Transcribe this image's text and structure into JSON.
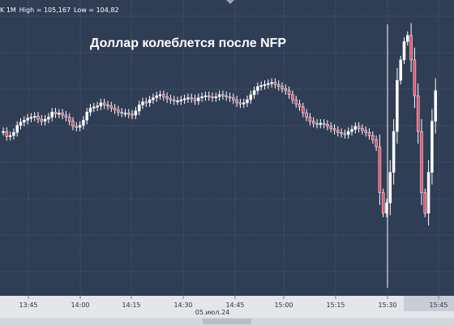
{
  "info": {
    "prefix": "K 1M",
    "high": "High = 105,167",
    "low": "Low = 104,82"
  },
  "headline": "Доллар колеблется после NFP",
  "colors": {
    "background": "#2f3d55",
    "axis_bar": "#e4e6ea",
    "grid": "#56627a",
    "up_candle": "#ffffff",
    "down_candle": "#e8506a",
    "news_line": "#ffffff"
  },
  "chart_data": {
    "type": "candlestick",
    "xlabel": "",
    "ylabel": "",
    "x_ticks": [
      "13:45",
      "14:00",
      "14:15",
      "14:30",
      "14:45",
      "15:00",
      "15:15",
      "15:30",
      "15:45"
    ],
    "date_label": "05.июл.24",
    "ylim": [
      104.82,
      105.167
    ],
    "high": 105.167,
    "low": 104.82,
    "grid": true,
    "series": [
      {
        "values": [
          105.0,
          104.995,
          104.996,
          104.999,
          105.006,
          105.009,
          105.011,
          105.013,
          105.014,
          105.015,
          105.012,
          105.01,
          105.012,
          105.014,
          105.019,
          105.017,
          105.018,
          105.016,
          105.014,
          105.01,
          105.005,
          105.004,
          105.006,
          105.011,
          105.019,
          105.023,
          105.024,
          105.025,
          105.028,
          105.026,
          105.025,
          105.023,
          105.021,
          105.019,
          105.018,
          105.018,
          105.017,
          105.016,
          105.02,
          105.026,
          105.029,
          105.028,
          105.031,
          105.033,
          105.035,
          105.036,
          105.034,
          105.032,
          105.031,
          105.03,
          105.03,
          105.031,
          105.032,
          105.033,
          105.032,
          105.03,
          105.033,
          105.034,
          105.035,
          105.034,
          105.033,
          105.034,
          105.036,
          105.035,
          105.034,
          105.033,
          105.031,
          105.028,
          105.027,
          105.028,
          105.031,
          105.036,
          105.04,
          105.044,
          105.045,
          105.046,
          105.047,
          105.048,
          105.046,
          105.044,
          105.042,
          105.04,
          105.036,
          105.031,
          105.027,
          105.024,
          105.018,
          105.014,
          105.01,
          105.008,
          105.007,
          105.008,
          105.007,
          105.005,
          105.003,
          105.001,
          104.999,
          104.998,
          104.997,
          105.0,
          105.002,
          105.005,
          105.003,
          105.001,
          104.999,
          104.996,
          104.992,
          104.985,
          104.94,
          104.92,
          104.93,
          104.96,
          105.0,
          105.05,
          105.07,
          105.088,
          105.094,
          105.07,
          105.035,
          105.0,
          104.94,
          104.92,
          104.96,
          105.01,
          105.04
        ]
      }
    ]
  }
}
